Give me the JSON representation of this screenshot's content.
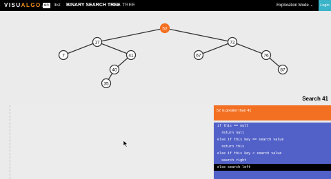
{
  "topbar": {
    "logo": {
      "part1": "VISU",
      "part2": "ALGO",
      "part3": ".net"
    },
    "lang": "en",
    "lang_path": "/bst",
    "title": "BINARY SEARCH TREE",
    "alt_title": "AVL TREE",
    "mode": "Exploration Mode",
    "login": "Login"
  },
  "tree": {
    "nodes": [
      "52",
      "17",
      "72",
      "7",
      "41",
      "67",
      "76",
      "40",
      "87",
      "35"
    ]
  },
  "status": {
    "title": "Search 41",
    "message": "52 is greater than 41"
  },
  "code": [
    "if this == null",
    "  return null",
    "else if this key == search value",
    "  return this",
    "else if this key < search value",
    "  search right",
    "else search left"
  ],
  "colors": {
    "accent": "#f36f21",
    "code_bg": "#5261c8",
    "login_bg": "#3bb4c9"
  }
}
